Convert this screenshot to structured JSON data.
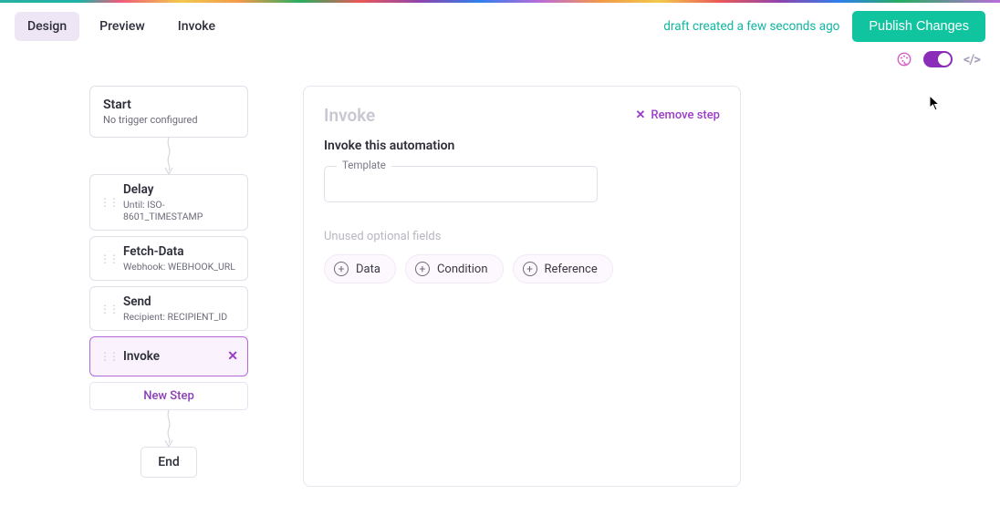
{
  "header": {
    "tabs": [
      "Design",
      "Preview",
      "Invoke"
    ],
    "active_tab": 0,
    "draft_status": "draft created a few seconds ago",
    "publish_label": "Publish Changes"
  },
  "toolbar": {
    "palette_icon": "palette-icon",
    "toggle_on": true,
    "code_icon_label": "</>"
  },
  "flow": {
    "start": {
      "title": "Start",
      "subtitle": "No trigger configured"
    },
    "steps": [
      {
        "title": "Delay",
        "subtitle": "Until: ISO-8601_TIMESTAMP",
        "selected": false
      },
      {
        "title": "Fetch-Data",
        "subtitle": "Webhook: WEBHOOK_URL",
        "selected": false
      },
      {
        "title": "Send",
        "subtitle": "Recipient: RECIPIENT_ID",
        "selected": false
      },
      {
        "title": "Invoke",
        "subtitle": "",
        "selected": true
      }
    ],
    "new_step_label": "New Step",
    "end_label": "End"
  },
  "detail": {
    "title": "Invoke",
    "remove_label": "Remove step",
    "section_heading": "Invoke this automation",
    "template_field": {
      "label": "Template",
      "value": ""
    },
    "optional_heading": "Unused optional fields",
    "chips": [
      "Data",
      "Condition",
      "Reference"
    ]
  }
}
